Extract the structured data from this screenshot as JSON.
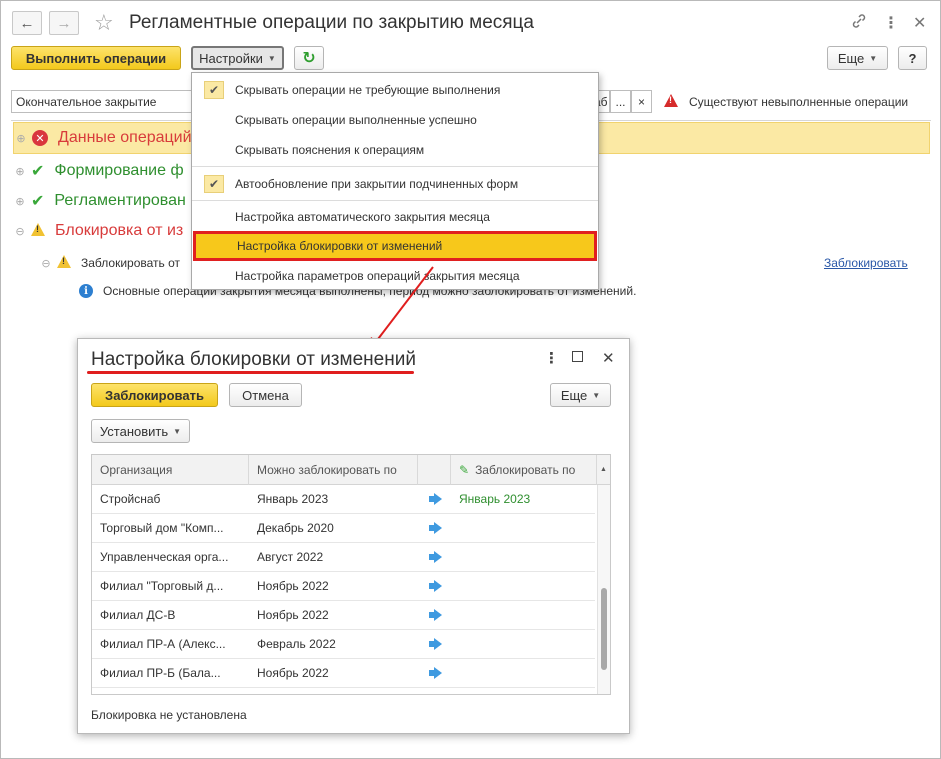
{
  "window": {
    "title": "Регламентные операции по закрытию месяца",
    "back_icon": "←",
    "forward_icon": "→",
    "star_icon": "☆",
    "link_icon": "🔗",
    "more_icon": "⋮",
    "close_icon": "✕"
  },
  "toolbar": {
    "run_label": "Выполнить операции",
    "settings_label": "Настройки",
    "refresh_icon": "↻",
    "more_label": "Еще",
    "help_label": "?"
  },
  "filter": {
    "mode_value": "Окончательное закрытие",
    "org_value_tail": "аб",
    "ellipsis_label": "...",
    "clear_label": "×",
    "warning_text": "Существуют невыполненные операции"
  },
  "tree": {
    "items": [
      {
        "label": "Данные операций",
        "status": "error"
      },
      {
        "label": "Формирование ф",
        "status": "ok"
      },
      {
        "label": "Регламентирован",
        "status": "ok"
      },
      {
        "label": "Блокировка от из",
        "status": "warning"
      }
    ],
    "sub_item_label": "Заблокировать от",
    "sub_item_link": "Заблокировать",
    "info_text": "Основные операции закрытия месяца выполнены, период можно заблокировать от изменений."
  },
  "menu": {
    "items": [
      {
        "label": "Скрывать операции не требующие выполнения",
        "checked": true
      },
      {
        "label": "Скрывать операции выполненные успешно",
        "checked": false
      },
      {
        "label": "Скрывать пояснения к операциям",
        "checked": false
      },
      {
        "label": "Автообновление при закрытии подчиненных форм",
        "checked": true
      },
      {
        "label": "Настройка автоматического закрытия месяца",
        "checked": false
      },
      {
        "label": "Настройка блокировки от изменений",
        "checked": false
      },
      {
        "label": "Настройка параметров операций закрытия месяца",
        "checked": false
      }
    ]
  },
  "dialog": {
    "title": "Настройка блокировки от изменений",
    "lock_label": "Заблокировать",
    "cancel_label": "Отмена",
    "more_label": "Еще",
    "set_label": "Установить",
    "columns": [
      "Организация",
      "Можно заблокировать по",
      "",
      "Заблокировать по"
    ],
    "rows": [
      {
        "org": "Стройснаб",
        "can_lock": "Январь 2023",
        "lock_to": "Январь 2023"
      },
      {
        "org": "Торговый дом \"Комп...",
        "can_lock": "Декабрь 2020",
        "lock_to": ""
      },
      {
        "org": "Управленческая орга...",
        "can_lock": "Август 2022",
        "lock_to": ""
      },
      {
        "org": "Филиал \"Торговый д...",
        "can_lock": "Ноябрь 2022",
        "lock_to": ""
      },
      {
        "org": "Филиал ДС-В",
        "can_lock": "Ноябрь 2022",
        "lock_to": ""
      },
      {
        "org": "Филиал ПР-А (Алекс...",
        "can_lock": "Февраль 2022",
        "lock_to": ""
      },
      {
        "org": "Филиал ПР-Б (Бала...",
        "can_lock": "Ноябрь 2022",
        "lock_to": ""
      }
    ],
    "status_text": "Блокировка не установлена"
  },
  "colors": {
    "accent_yellow": "#f3c91c",
    "highlight_red": "#e02020",
    "error_red": "#d83b3b",
    "ok_green": "#2f8f2f",
    "link_blue": "#2a58a8"
  }
}
